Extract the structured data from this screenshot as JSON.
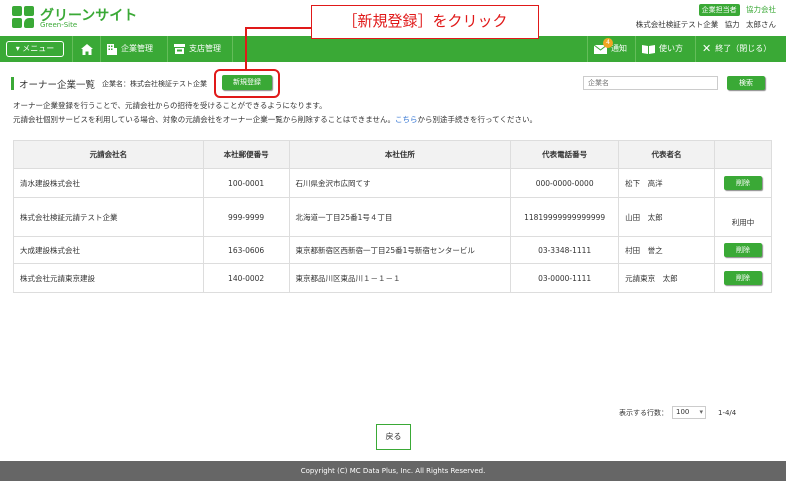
{
  "header": {
    "logo_title": "グリーンサイト",
    "logo_sub": "Green-Site",
    "role_badge": "企業担当者",
    "role_company": "協力会社",
    "user_company": "株式会社検証テスト企業",
    "user_role": "協力",
    "user_name": "太郎さん"
  },
  "callout": {
    "text": "［新規登録］をクリック"
  },
  "nav": {
    "menu_label": "メニュー",
    "company_mgmt": "企業管理",
    "branch_mgmt": "支店管理",
    "notify_label": "通知",
    "notify_count": "4",
    "howto_label": "使い方",
    "exit_label": "終了（閉じる）"
  },
  "page": {
    "title": "オーナー企業一覧",
    "company_label": "企業名：株式会社検証テスト企業",
    "new_button": "新規登録",
    "search_placeholder": "企業名",
    "search_button": "検索",
    "desc1": "オーナー企業登録を行うことで、元請会社からの招待を受けることができるようになります。",
    "desc2_pre": "元請会社個別サービスを利用している場合、対象の元請会社をオーナー企業一覧から削除することはできません。",
    "desc2_link": "こちら",
    "desc2_post": "から別途手続きを行ってください。"
  },
  "table": {
    "headers": [
      "元請会社名",
      "本社郵便番号",
      "本社住所",
      "代表電話番号",
      "代表者名",
      ""
    ],
    "rows": [
      {
        "name": "清水建設株式会社",
        "zip": "100-0001",
        "address": "石川県金沢市広岡てす",
        "phone": "000-0000-0000",
        "rep": "松下　高洋",
        "action": "削除",
        "is_button": true
      },
      {
        "name": "株式会社検証元請テスト企業",
        "zip": "999-9999",
        "address": "北海道一丁目25番1号４丁目",
        "phone": "11819999999999999",
        "rep": "山田　太郎",
        "action": "利用中",
        "is_button": false
      },
      {
        "name": "大成建設株式会社",
        "zip": "163-0606",
        "address": "東京都新宿区西新宿一丁目25番1号新宿センタービル",
        "phone": "03-3348-1111",
        "rep": "村田　誉之",
        "action": "削除",
        "is_button": true
      },
      {
        "name": "株式会社元請東京建設",
        "zip": "140-0002",
        "address": "東京都品川区東品川１－１－１",
        "phone": "03-0000-1111",
        "rep": "元請東京　太郎",
        "action": "削除",
        "is_button": true
      }
    ]
  },
  "pager": {
    "label": "表示する行数：",
    "value": "100",
    "count": "1-4/4"
  },
  "back_button": "戻る",
  "footer": "Copyright (C) MC Data Plus, Inc. All Rights Reserved."
}
